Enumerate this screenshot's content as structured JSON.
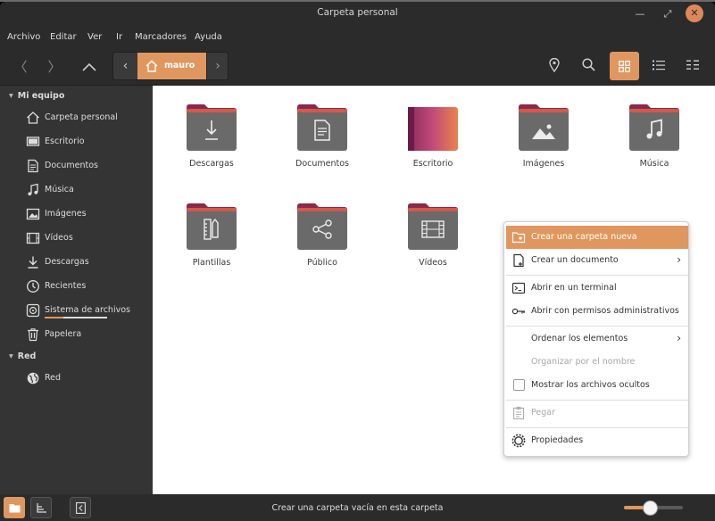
{
  "window": {
    "title": "Carpeta personal"
  },
  "menubar": [
    "Archivo",
    "Editar",
    "Ver",
    "Ir",
    "Marcadores",
    "Ayuda"
  ],
  "pathbar": {
    "current": "mauro"
  },
  "sidebar": {
    "section1": "Mi equipo",
    "items": [
      {
        "label": "Carpeta personal",
        "icon": "home-icon"
      },
      {
        "label": "Escritorio",
        "icon": "desktop-icon"
      },
      {
        "label": "Documentos",
        "icon": "document-icon"
      },
      {
        "label": "Música",
        "icon": "music-icon"
      },
      {
        "label": "Imágenes",
        "icon": "image-icon"
      },
      {
        "label": "Vídeos",
        "icon": "video-icon"
      },
      {
        "label": "Descargas",
        "icon": "download-icon"
      },
      {
        "label": "Recientes",
        "icon": "clock-icon"
      },
      {
        "label": "Sistema de archivos",
        "icon": "disk-icon"
      },
      {
        "label": "Papelera",
        "icon": "trash-icon"
      }
    ],
    "section2": "Red",
    "network": [
      {
        "label": "Red",
        "icon": "globe-icon"
      }
    ]
  },
  "folders": [
    {
      "label": "Descargas",
      "icon": "download-icon"
    },
    {
      "label": "Documentos",
      "icon": "document-icon"
    },
    {
      "label": "Escritorio",
      "icon": "desktop-icon"
    },
    {
      "label": "Imágenes",
      "icon": "image-icon"
    },
    {
      "label": "Música",
      "icon": "music-icon"
    },
    {
      "label": "Plantillas",
      "icon": "template-icon"
    },
    {
      "label": "Público",
      "icon": "share-icon"
    },
    {
      "label": "Vídeos",
      "icon": "video-icon"
    }
  ],
  "context_menu": {
    "items": [
      {
        "label": "Crear una carpeta nueva",
        "icon": "new-folder-icon"
      },
      {
        "label": "Crear un documento",
        "icon": "new-document-icon"
      },
      {
        "label": "Abrir en un terminal",
        "icon": "terminal-icon"
      },
      {
        "label": "Abrir con permisos administrativos",
        "icon": "key-icon"
      },
      {
        "label": "Ordenar los elementos"
      },
      {
        "label": "Organizar por el nombre"
      },
      {
        "label": "Mostrar los archivos ocultos"
      },
      {
        "label": "Pegar",
        "icon": "paste-icon"
      },
      {
        "label": "Propiedades",
        "icon": "gear-icon"
      }
    ]
  },
  "statusbar": {
    "text": "Crear una carpeta vacía en esta carpeta",
    "zoom_level": 0.45
  },
  "colors": {
    "accent": "#e0975f",
    "folder_top": "#8a2a4a",
    "folder_body": "#6a6a6a"
  }
}
